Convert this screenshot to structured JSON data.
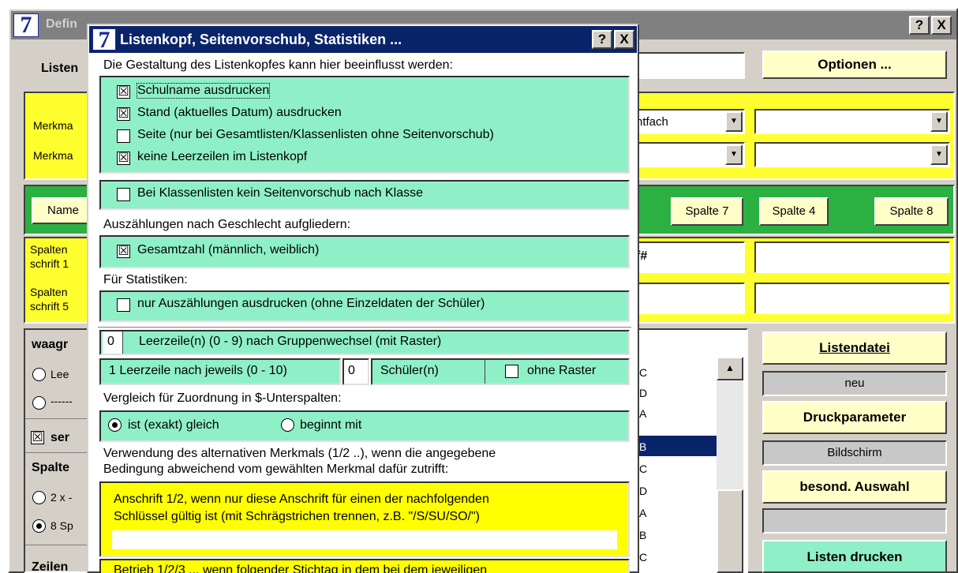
{
  "main": {
    "title": "Defin",
    "help_label": "?",
    "close_label": "X",
    "listen_label": "Listen",
    "optionen_label": "Optionen ...",
    "merkmal1_label": "Merkma",
    "merkmal2_label": "Merkma",
    "combo1_value": "ntfach",
    "name_label": "Name",
    "spalte7_label": "Spalte 7",
    "spalte4_label": "Spalte 4",
    "spalte8_label": "Spalte 8",
    "spalten1_label_a": "Spalten",
    "spalten1_label_b": "schrift 1",
    "spalten5_label_a": "Spalten",
    "spalten5_label_b": "schrift 5",
    "field_value": "f#",
    "waagr_label": "waagr",
    "lee_label": "Lee",
    "dash_label": "------",
    "ser_label": "ser",
    "spalte_label": "Spalte",
    "two_x_label": "2 x -",
    "eight_sp_label": "8 Sp",
    "zeilen_label": "Zeilen",
    "list_letters": [
      "C",
      "D",
      "A",
      "B",
      "C",
      "D",
      "A",
      "B",
      "C"
    ],
    "listendatei_label": "Listendatei",
    "neu_label": "neu",
    "druckparameter_label": "Druckparameter",
    "bildschirm_label": "Bildschirm",
    "besond_label": "besond. Auswahl",
    "listen_drucken_label": "Listen drucken"
  },
  "dialog": {
    "logo": "7",
    "title": "Listenkopf, Seitenvorschub, Statistiken ...",
    "help_label": "?",
    "close_label": "X",
    "intro": "Die Gestaltung des Listenkopfes kann  hier beeinflusst werden:",
    "opt_schulname": "Schulname ausdrucken",
    "opt_stand": "Stand (aktuelles Datum) ausdrucken",
    "opt_seite": "Seite (nur bei Gesamtlisten/Klassenlisten ohne Seitenvorschub)",
    "opt_leerzeilen": "keine Leerzeilen im Listenkopf",
    "opt_klassen": "Bei Klassenlisten kein Seitenvorschub nach Klasse",
    "geschlecht_heading": "Auszählungen nach Geschlecht aufgliedern:",
    "opt_gesamtzahl": "Gesamtzahl (männlich, weiblich)",
    "statistik_heading": "Für Statistiken:",
    "opt_nur_auszaehlungen": "nur Auszählungen ausdrucken (ohne Einzeldaten der Schüler)",
    "leerzeilen_value": "0",
    "leerzeilen_text": "Leerzeile(n) (0 - 9) nach Gruppenwechsel (mit Raster)",
    "leerzeile_nach_text": "1 Leerzeile nach jeweils (0 - 10)",
    "schueler_value": "0",
    "schueler_text": "Schüler(n)",
    "ohne_raster": "ohne Raster",
    "vergleich_heading": "Vergleich für Zuordnung in $-Unterspalten:",
    "radio_exakt": "ist (exakt) gleich",
    "radio_beginnt": "beginnt mit",
    "alt_heading_1": "Verwendung des alternativen Merkmals (1/2 ..), wenn die angegebene",
    "alt_heading_2": "Bedingung abweichend vom gewählten Merkmal dafür zutrifft:",
    "anschrift_1": "Anschrift 1/2, wenn nur diese Anschrift für einen der nachfolgenden",
    "anschrift_2": "Schlüssel gültig ist (mit Schrägstrichen trennen, z.B. \"/S/SU/SO/\")",
    "betrieb_text": "Betrieb 1/2/3 ... wenn folgender Stichtag in dem bei dem jeweiligen"
  }
}
